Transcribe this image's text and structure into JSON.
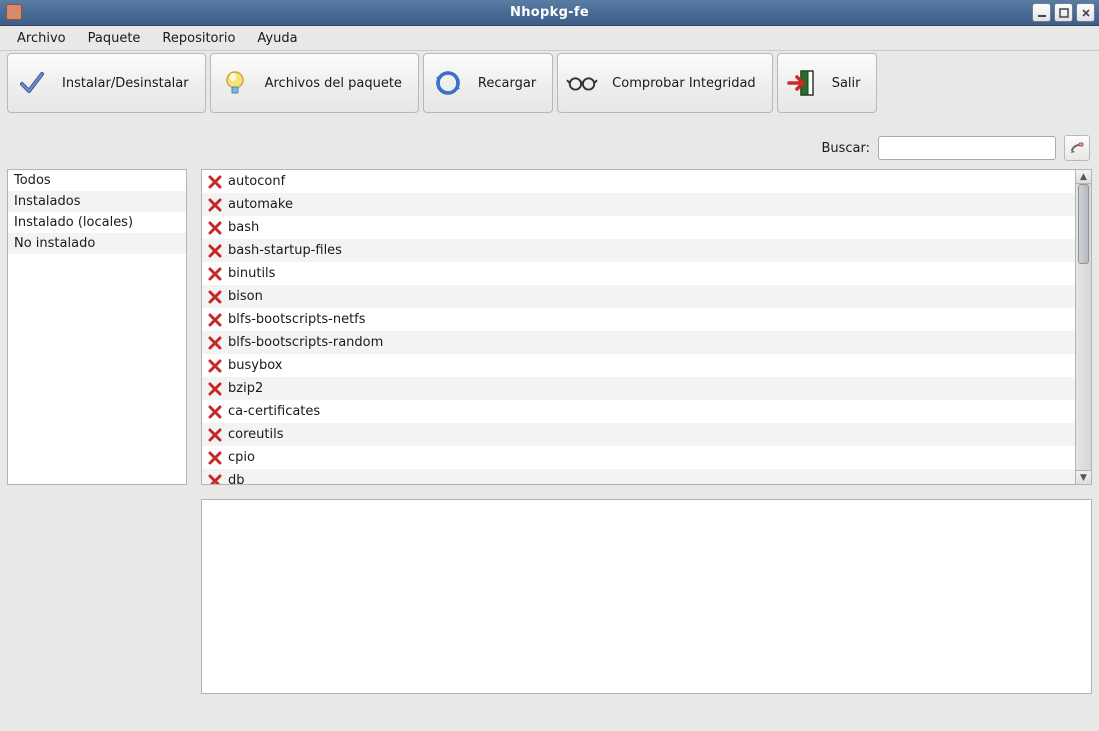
{
  "window": {
    "title": "Nhopkg-fe"
  },
  "menu": {
    "items": [
      "Archivo",
      "Paquete",
      "Repositorio",
      "Ayuda"
    ]
  },
  "toolbar": {
    "install_label": "Instalar/Desinstalar",
    "files_label": "Archivos del paquete",
    "reload_label": "Recargar",
    "integrity_label": "Comprobar Integridad",
    "exit_label": "Salir"
  },
  "search": {
    "label": "Buscar:",
    "value": ""
  },
  "filters": {
    "items": [
      "Todos",
      "Instalados",
      "Instalado (locales)",
      "No instalado"
    ]
  },
  "packages": {
    "status_icon": "not-installed",
    "list": [
      "autoconf",
      "automake",
      "bash",
      "bash-startup-files",
      "binutils",
      "bison",
      "blfs-bootscripts-netfs",
      "blfs-bootscripts-random",
      "busybox",
      "bzip2",
      "ca-certificates",
      "coreutils",
      "cpio",
      "db"
    ]
  },
  "detail": {
    "text": ""
  }
}
